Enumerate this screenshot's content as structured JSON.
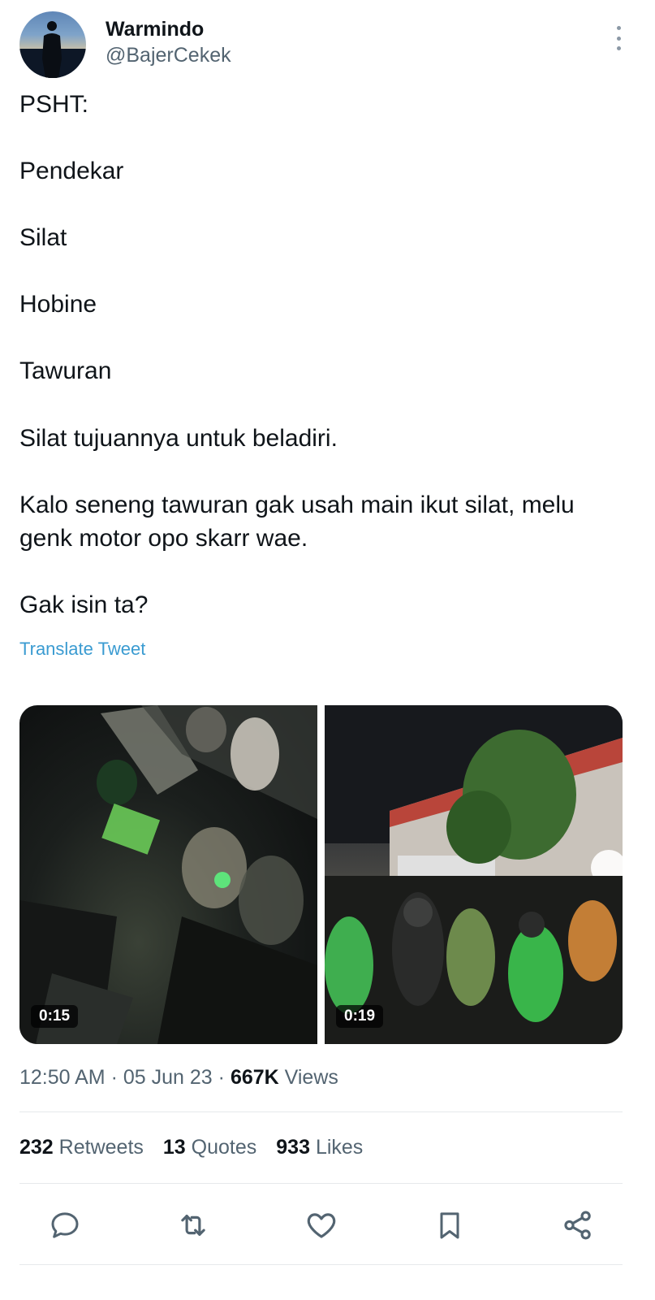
{
  "author": {
    "display_name": "Warmindo",
    "handle": "@BajerCekek"
  },
  "tweet": {
    "lines": [
      "PSHT:",
      "Pendekar",
      "Silat",
      "Hobine",
      "Tawuran",
      "Silat tujuannya untuk beladiri.",
      "Kalo seneng tawuran gak usah main ikut silat, melu",
      "genk motor opo skarr wae.",
      "Gak isin ta?"
    ],
    "translate_label": "Translate Tweet"
  },
  "media": {
    "videos": [
      {
        "duration": "0:15"
      },
      {
        "duration": "0:19"
      }
    ]
  },
  "meta": {
    "time": "12:50 AM",
    "date": "05 Jun 23",
    "views_count": "667K",
    "views_label": "Views"
  },
  "stats": {
    "retweets_count": "232",
    "retweets_label": "Retweets",
    "quotes_count": "13",
    "quotes_label": "Quotes",
    "likes_count": "933",
    "likes_label": "Likes"
  },
  "actions": {
    "icons": [
      "reply-icon",
      "retweet-icon",
      "like-icon",
      "bookmark-icon",
      "share-icon"
    ]
  },
  "colors": {
    "link": "#3a9bd1",
    "secondary_text": "#536471",
    "primary_text": "#0f1419",
    "icon": "#536471"
  }
}
